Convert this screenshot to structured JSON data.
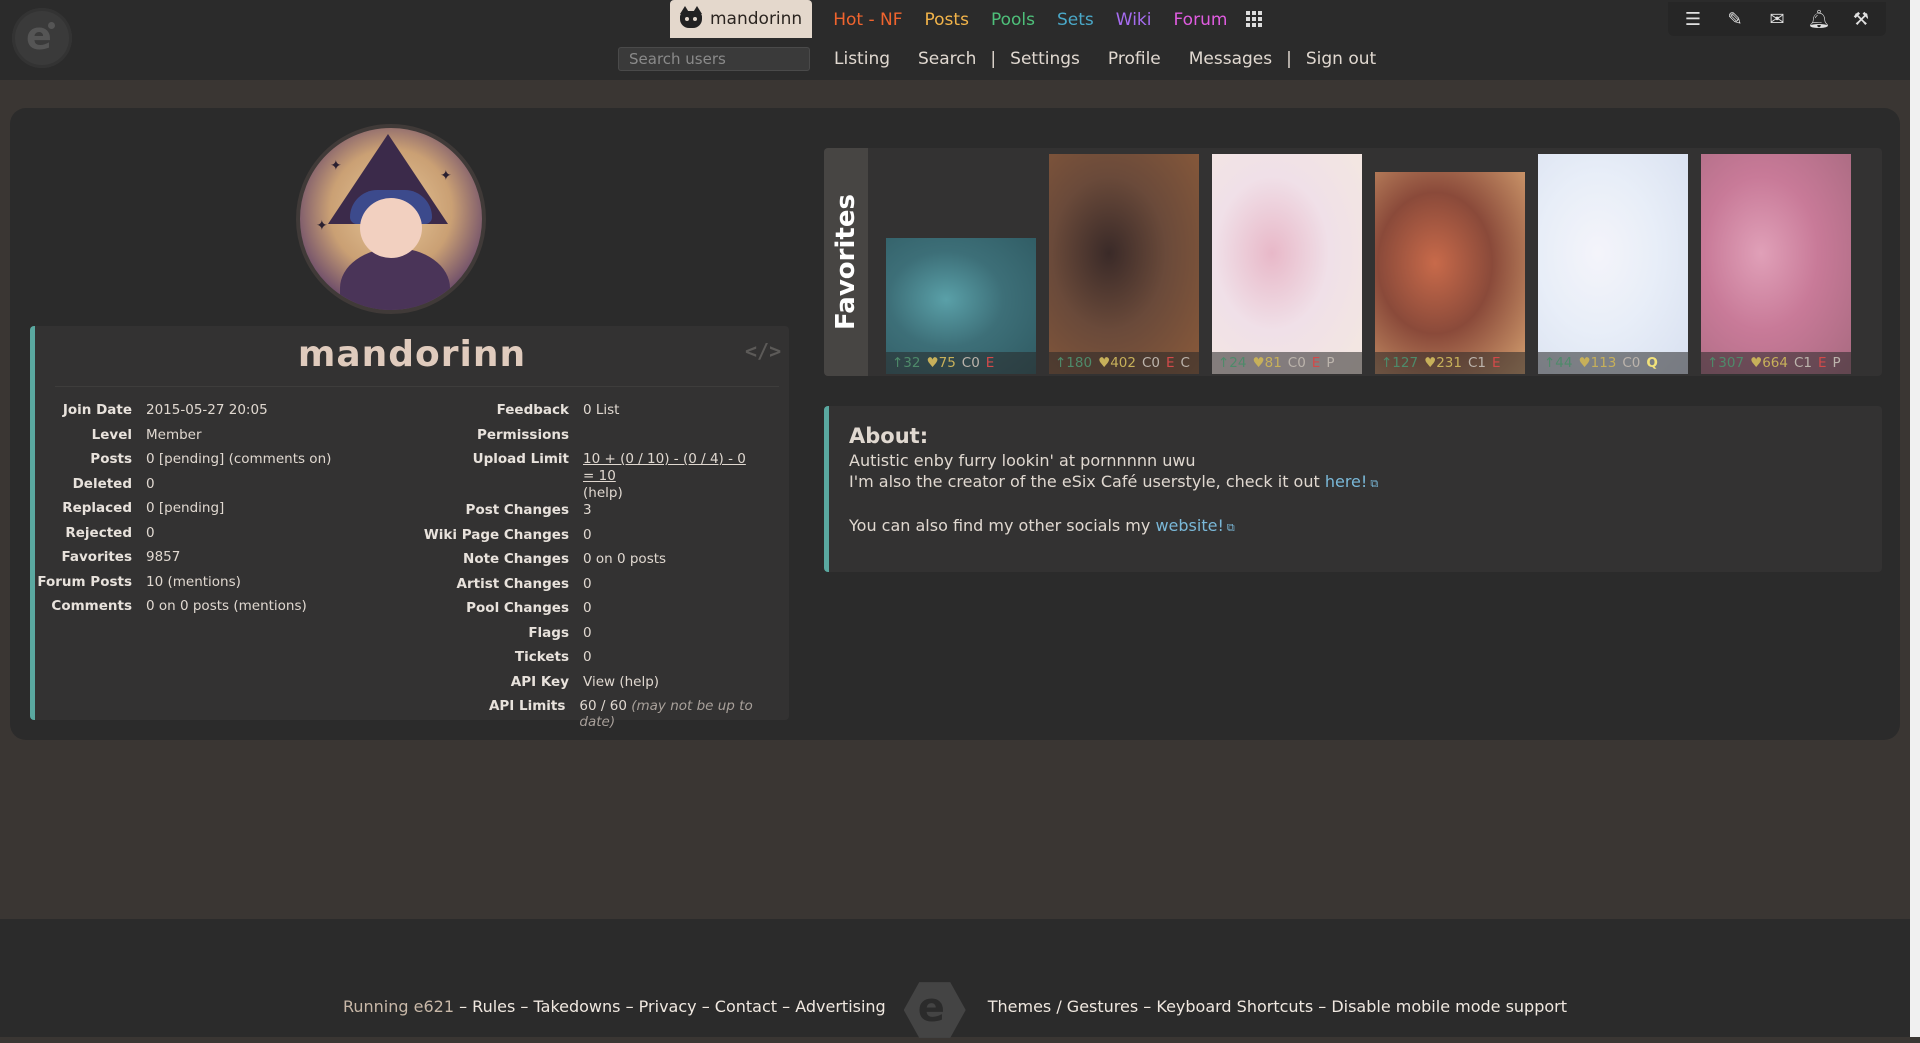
{
  "nav": {
    "user_tab": "mandorinn",
    "items": [
      {
        "label": "Hot - NF",
        "color": "#f0642e"
      },
      {
        "label": "Posts",
        "color": "#f2b44a"
      },
      {
        "label": "Pools",
        "color": "#4ec07a"
      },
      {
        "label": "Sets",
        "color": "#4aa8c8"
      },
      {
        "label": "Wiki",
        "color": "#a66cf0"
      },
      {
        "label": "Forum",
        "color": "#e05ce0"
      }
    ],
    "search_placeholder": "Search users",
    "sub_links": [
      "Listing",
      "Search",
      "Settings",
      "Profile",
      "Messages",
      "Sign out"
    ],
    "tools": [
      "checklist-icon",
      "brush-icon",
      "mail-icon",
      "bell-icon",
      "wrench-icon"
    ]
  },
  "profile": {
    "username": "mandorinn",
    "left": [
      {
        "key": "Join Date",
        "value": "2015-05-27 20:05"
      },
      {
        "key": "Level",
        "value": "Member"
      },
      {
        "key": "Posts",
        "value": "0 [pending] (comments on)"
      },
      {
        "key": "Deleted",
        "value": "0"
      },
      {
        "key": "Replaced",
        "value": "0 [pending]"
      },
      {
        "key": "Rejected",
        "value": "0"
      },
      {
        "key": "Favorites",
        "value": "9857"
      },
      {
        "key": "Forum Posts",
        "value": "10 (mentions)"
      },
      {
        "key": "Comments",
        "value": "0 on 0 posts (mentions)"
      }
    ],
    "right": [
      {
        "key": "Feedback",
        "value": "0 List"
      },
      {
        "key": "Permissions",
        "value": ""
      },
      {
        "key": "Upload Limit",
        "value": "10 + (0 / 10) - (0 / 4) - 0 = 10",
        "value2": "(help)"
      },
      {
        "key": "Post Changes",
        "value": "3"
      },
      {
        "key": "Wiki Page Changes",
        "value": "0"
      },
      {
        "key": "Note Changes",
        "value": "0 on 0 posts"
      },
      {
        "key": "Artist Changes",
        "value": "0"
      },
      {
        "key": "Pool Changes",
        "value": "0"
      },
      {
        "key": "Flags",
        "value": "0"
      },
      {
        "key": "Tickets",
        "value": "0"
      },
      {
        "key": "API Key",
        "value": "View (help)"
      },
      {
        "key": "API Limits",
        "value": "60 / 60",
        "note": "(may not be up to date)"
      }
    ]
  },
  "favorites": {
    "label": "Favorites",
    "thumbs": [
      {
        "up": "↑32",
        "fav": "♥75",
        "com": "C0",
        "rating": "E",
        "extra": "",
        "colors": [
          "#3d6f78",
          "#5aa0a8",
          "#2f5a62"
        ],
        "height_frac": 0.62
      },
      {
        "up": "↑180",
        "fav": "♥402",
        "com": "C0",
        "rating": "E",
        "extra": "C",
        "colors": [
          "#6a4a3a",
          "#3a2a28",
          "#8a5a3a"
        ],
        "height_frac": 1.0
      },
      {
        "up": "↑24",
        "fav": "♥81",
        "com": "C0",
        "rating": "E",
        "extra": "P",
        "colors": [
          "#f0e0e8",
          "#e8b8c8",
          "#f4e8e0"
        ],
        "height_frac": 1.0
      },
      {
        "up": "↑127",
        "fav": "♥231",
        "com": "C1",
        "rating": "E",
        "extra": "",
        "colors": [
          "#8a4a3a",
          "#c86a4a",
          "#d4a070"
        ],
        "height_frac": 0.92
      },
      {
        "up": "↑44",
        "fav": "♥113",
        "com": "C0",
        "rating": "Q",
        "extra": "",
        "colors": [
          "#e8eef8",
          "#f4f4fa",
          "#d8e0f0"
        ],
        "height_frac": 1.0
      },
      {
        "up": "↑307",
        "fav": "♥664",
        "com": "C1",
        "rating": "E",
        "extra": "P",
        "colors": [
          "#c87a98",
          "#e0a0b8",
          "#a86a80"
        ],
        "height_frac": 1.0
      }
    ]
  },
  "about": {
    "title": "About:",
    "line1": "Autistic enby furry lookin' at pornnnnn uwu",
    "line2_prefix": "I'm also the creator of the eSix Café userstyle, check it out ",
    "line2_link": "here!",
    "line3_prefix": "You can also find my other socials my ",
    "line3_link": "website!"
  },
  "footer": {
    "running": "Running e621",
    "left_links": [
      "Rules",
      "Takedowns",
      "Privacy",
      "Contact",
      "Advertising"
    ],
    "right_links": [
      "Themes / Gestures",
      "Keyboard Shortcuts",
      "Disable mobile mode support"
    ]
  }
}
